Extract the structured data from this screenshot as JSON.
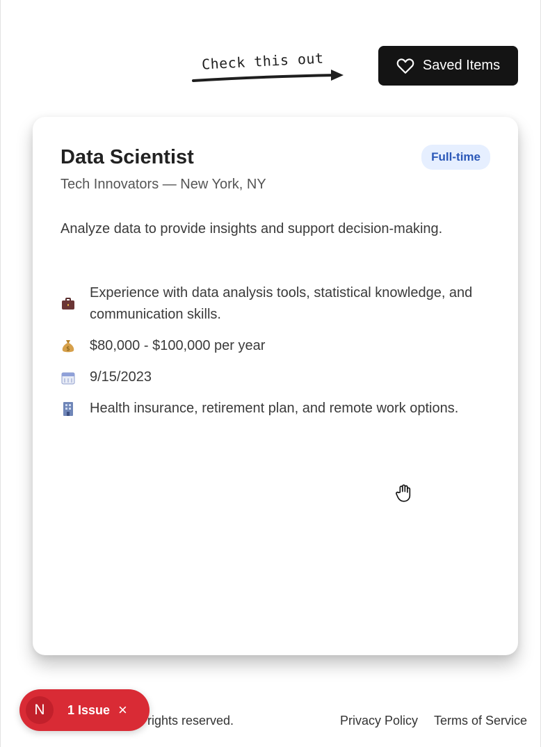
{
  "header": {
    "hint_text": "Check this out",
    "saved_button_label": "Saved Items"
  },
  "job": {
    "title": "Data Scientist",
    "badge": "Full-time",
    "company_location": "Tech Innovators — New York, NY",
    "description": "Analyze data to provide insights and support decision-making.",
    "details": [
      {
        "icon": "briefcase-icon",
        "text": "Experience with data analysis tools, statistical knowledge, and communication skills."
      },
      {
        "icon": "money-bag-icon",
        "text": "$80,000 - $100,000 per year"
      },
      {
        "icon": "calendar-icon",
        "text": "9/15/2023"
      },
      {
        "icon": "building-icon",
        "text": "Health insurance, retirement plan, and remote work options."
      }
    ]
  },
  "footer": {
    "rights": "rights reserved.",
    "privacy": "Privacy Policy",
    "terms": "Terms of Service"
  },
  "issues": {
    "avatar": "N",
    "label": "1 Issue",
    "close": "×"
  },
  "colors": {
    "button_bg": "#141414",
    "badge_bg": "#e6efff",
    "badge_text": "#2b58b8",
    "issue_bg": "#d92b35"
  }
}
